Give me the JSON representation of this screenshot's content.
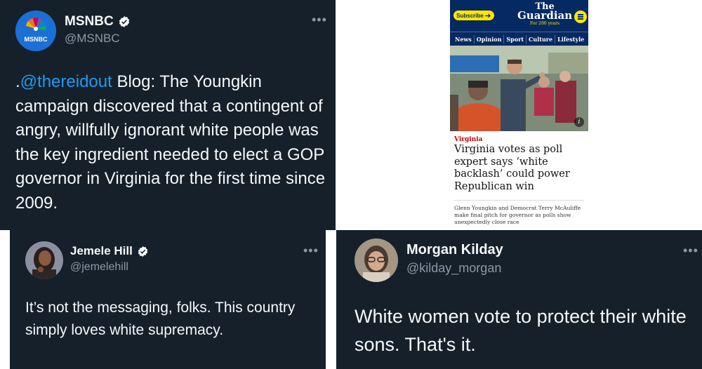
{
  "msnbc_tweet": {
    "display_name": "MSNBC",
    "handle": "@MSNBC",
    "avatar_text": "MSNBC",
    "verified": true,
    "text_lead": ".",
    "mention": "@thereidout",
    "text_body": " Blog: The Youngkin campaign discovered that a contingent of angry, willfully ignorant white people was the key ingredient needed to elect a GOP governor in Virginia for the first time since 2009.",
    "more_icon": "ellipsis-icon"
  },
  "guardian_article": {
    "subscribe_label": "Subscribe",
    "logo_the": "The",
    "logo_guardian": "Guardian",
    "logo_sub": "For 200 years",
    "nav": [
      "News",
      "Opinion",
      "Sport",
      "Culture",
      "Lifestyle"
    ],
    "kicker": "Virginia",
    "headline": "Virginia votes as poll expert says ‘white backlash’ could power Republican win",
    "standfirst": "Glenn Youngkin and Democrat Terry McAuliffe make final pitch for governor as polls show unexpectedly close race",
    "info_label": "i",
    "menu_icon": "hamburger-menu-icon",
    "arrow_icon": "arrow-right-icon"
  },
  "jemele_tweet": {
    "display_name": "Jemele Hill",
    "handle": "@jemelehill",
    "verified": true,
    "text": "It’s not the messaging, folks. This country simply loves white supremacy.",
    "more_icon": "ellipsis-icon"
  },
  "morgan_tweet": {
    "display_name": "Morgan Kilday",
    "handle": "@kilday_morgan",
    "verified": false,
    "text": "White women vote to protect their white sons. That's it.",
    "more_icon": "ellipsis-icon"
  },
  "colors": {
    "twitter_dark_bg": "#15202b",
    "twitter_text": "#f7f9f9",
    "twitter_secondary": "#8b98a5",
    "twitter_link": "#1d9bf0",
    "guardian_navy": "#052962",
    "guardian_yellow": "#ffe500",
    "guardian_red": "#c70000"
  }
}
